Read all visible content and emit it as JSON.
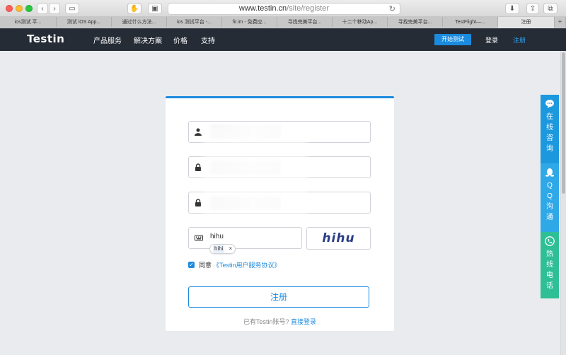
{
  "browser": {
    "url_host": "www.testin.cn",
    "url_path": "/site/register",
    "tabs": [
      {
        "label": "ios测试 平...",
        "active": false
      },
      {
        "label": "测试 iOS App...",
        "active": false
      },
      {
        "label": "通过什么方法...",
        "active": false
      },
      {
        "label": "ios 测试平台 -...",
        "active": false
      },
      {
        "label": "fir.im - 免费应...",
        "active": false
      },
      {
        "label": "寻找完美平台...",
        "active": false
      },
      {
        "label": "十二个移动Ap...",
        "active": false
      },
      {
        "label": "寻找完美平台...",
        "active": false
      },
      {
        "label": "TestFlight—...",
        "active": false
      },
      {
        "label": "注册",
        "active": true
      }
    ],
    "new_tab_symbol": "+"
  },
  "nav": {
    "logo": "Testin",
    "items": [
      "产品服务",
      "解决方案",
      "价格",
      "支持"
    ],
    "start_button": "开始测试",
    "login": "登录",
    "register": "注册"
  },
  "form": {
    "captcha_value": "hihu",
    "suggestion": "hihi",
    "suggestion_close": "×",
    "captcha_image_text": "hihu",
    "agree_text": "同意",
    "agree_link": "《Testin用户服务协议》",
    "submit": "注册",
    "have_account": "已有Testin账号?",
    "login_link": "直接登录"
  },
  "side_panel": {
    "chat": "在\n线\n咨\n询",
    "qq": "Q\nQ\n沟\n通",
    "phone": "热\n线\n电\n话"
  },
  "colors": {
    "accent": "#1c8ae0",
    "navbar": "#262c36",
    "side_chat": "#1c98df",
    "side_qq": "#2fa8e8",
    "side_phone": "#2fbf96"
  }
}
